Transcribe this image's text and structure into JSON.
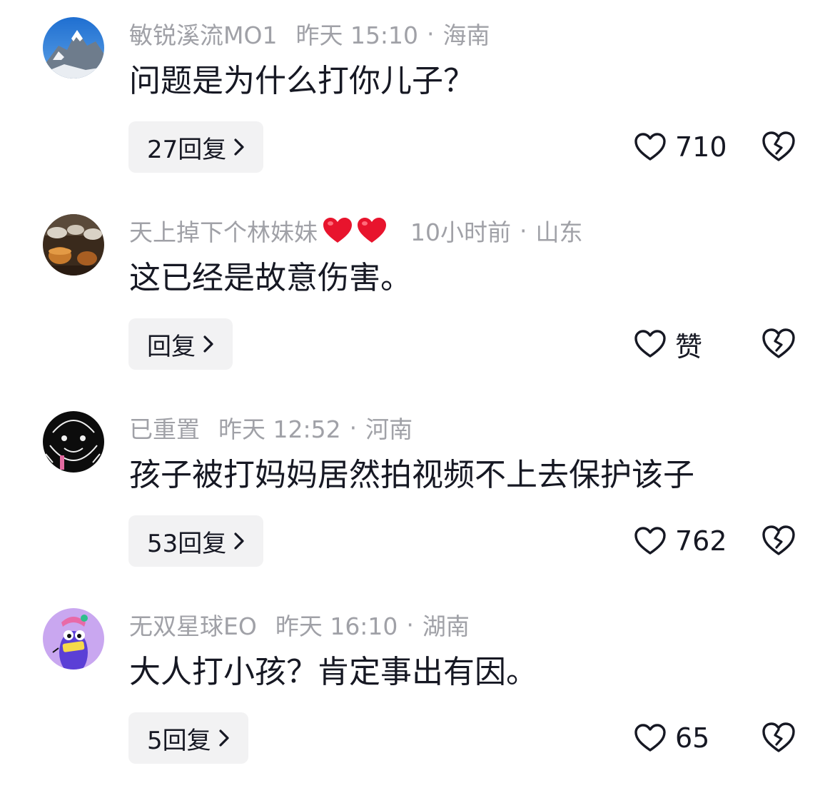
{
  "comments": [
    {
      "username": "敏锐溪流MO1",
      "time": "昨天 15:10",
      "separator": "·",
      "location": "海南",
      "text": "问题是为什么打你儿子？",
      "reply_label": "27回复",
      "like_count": "710",
      "avatar": "mountain-photo"
    },
    {
      "username": "天上掉下个林妹妹",
      "username_emoji": [
        "red-heart",
        "red-heart"
      ],
      "time": "10小时前",
      "separator": "·",
      "location": "山东",
      "text": "这已经是故意伤害。",
      "reply_label": "回复",
      "like_count": "赞",
      "avatar": "tea-photo"
    },
    {
      "username": "已重置",
      "time": "昨天 12:52",
      "separator": "·",
      "location": "河南",
      "text": "孩子被打妈妈居然拍视频不上去保护该子",
      "reply_label": "53回复",
      "like_count": "762",
      "avatar": "dark-doodle"
    },
    {
      "username": "无双星球EO",
      "time": "昨天 16:10",
      "separator": "·",
      "location": "湖南",
      "text": "大人打小孩？肯定事出有因。",
      "reply_label": "5回复",
      "like_count": "65",
      "avatar": "purple-cartoon"
    }
  ],
  "icons": {
    "like": "heart-outline-icon",
    "dislike": "broken-heart-icon",
    "reply_chevron": "chevron-right-icon"
  },
  "colors": {
    "meta_text": "#a0a1a7",
    "body_text": "#161823",
    "reply_bg": "#f2f2f3",
    "emoji_heart": "#e8142d"
  }
}
